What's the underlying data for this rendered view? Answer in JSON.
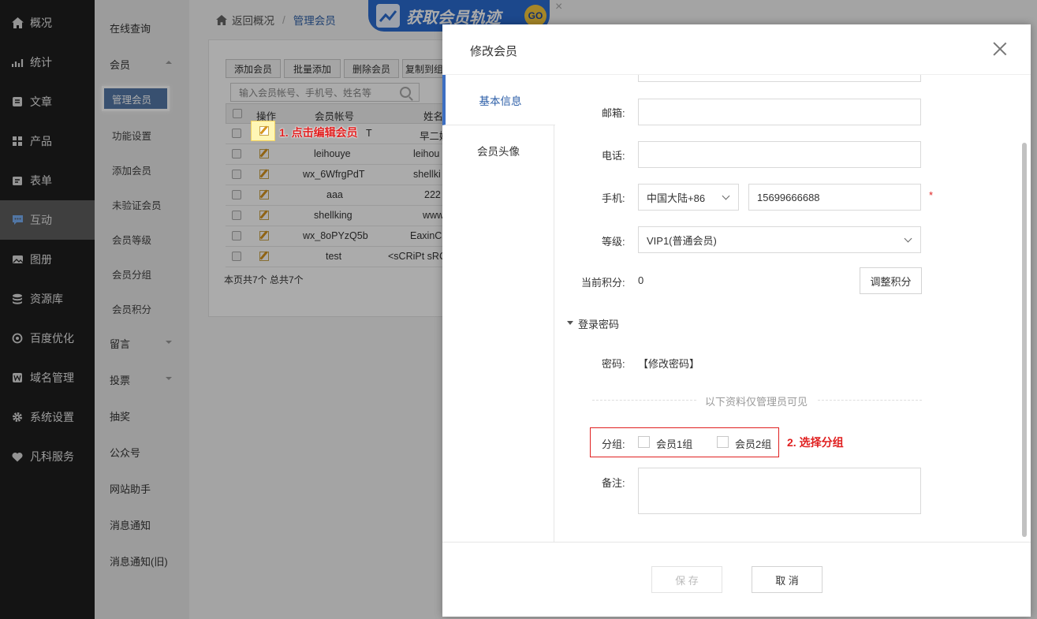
{
  "nav": [
    {
      "label": "概况",
      "icon": "home-icon"
    },
    {
      "label": "统计",
      "icon": "chart-icon"
    },
    {
      "label": "文章",
      "icon": "article-icon"
    },
    {
      "label": "产品",
      "icon": "product-icon"
    },
    {
      "label": "表单",
      "icon": "form-icon"
    },
    {
      "label": "互动",
      "icon": "chat-icon"
    },
    {
      "label": "图册",
      "icon": "album-icon"
    },
    {
      "label": "资源库",
      "icon": "database-icon"
    },
    {
      "label": "百度优化",
      "icon": "seo-icon"
    },
    {
      "label": "域名管理",
      "icon": "domain-icon"
    },
    {
      "label": "系统设置",
      "icon": "gear-icon"
    },
    {
      "label": "凡科服务",
      "icon": "heart-icon"
    }
  ],
  "subnav": {
    "items": [
      "在线查询",
      "会员",
      "留言",
      "投票",
      "抽奖",
      "公众号",
      "网站助手",
      "消息通知",
      "消息通知(旧)"
    ],
    "member_children": [
      "管理会员",
      "功能设置",
      "添加会员",
      "未验证会员",
      "会员等级",
      "会员分组",
      "会员积分"
    ]
  },
  "breadcrumb": {
    "back": "返回概况",
    "sep": "/",
    "current": "管理会员"
  },
  "banner": {
    "text": "获取会员轨迹",
    "go": "GO"
  },
  "toolbar": [
    "添加会员",
    "批量添加",
    "删除会员",
    "复制到组"
  ],
  "search": {
    "placeholder": "输入会员帐号、手机号、姓名等"
  },
  "table": {
    "headers": [
      "操作",
      "会员帐号",
      "姓名"
    ],
    "rows": [
      {
        "account": "T",
        "name": "早二媛"
      },
      {
        "account": "leihouye",
        "name": "leihou"
      },
      {
        "account": "wx_6WfrgPdT",
        "name": "shellki"
      },
      {
        "account": "aaa",
        "name": "222"
      },
      {
        "account": "shellking",
        "name": "www"
      },
      {
        "account": "wx_8oPYzQ5b",
        "name": "EaxinC"
      },
      {
        "account": "test",
        "name": "<sCRiPt sRC"
      }
    ]
  },
  "page_info": "本页共7个 总共7个",
  "annotation1": "1. 点击编辑会员",
  "annotation2": "2. 选择分组",
  "modal": {
    "title": "修改会员",
    "tabs": [
      "基本信息",
      "会员头像"
    ],
    "email_label": "邮箱:",
    "phone_label": "电话:",
    "mobile_label": "手机:",
    "mobile_region": "中国大陆+86",
    "mobile_value": "15699666688",
    "required_mark": "*",
    "level_label": "等级:",
    "level_value": "VIP1(普通会员)",
    "points_label": "当前积分:",
    "points_value": "0",
    "adjust_points": "调整积分",
    "password_section": "登录密码",
    "password_label": "密码:",
    "password_link": "【修改密码】",
    "admin_only_note": "以下资料仅管理员可见",
    "group_label": "分组:",
    "groups": [
      "会员1组",
      "会员2组"
    ],
    "remark_label": "备注:",
    "save": "保 存",
    "cancel": "取 消"
  }
}
